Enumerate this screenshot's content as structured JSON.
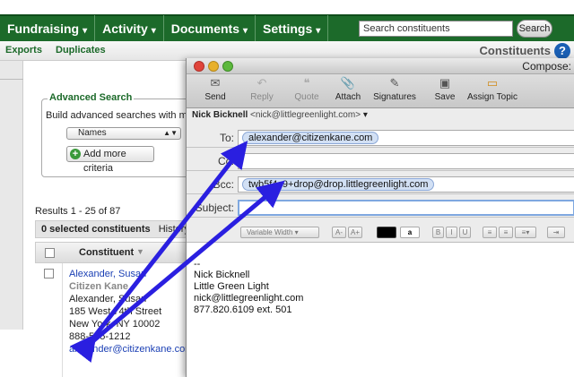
{
  "nav": {
    "items": [
      {
        "label": "Fundraising",
        "caret": "▾"
      },
      {
        "label": "Activity",
        "caret": "▾"
      },
      {
        "label": "Documents",
        "caret": "▾"
      },
      {
        "label": "Settings",
        "caret": "▾"
      }
    ],
    "search_value": "Search constituents",
    "search_button": "Search"
  },
  "subnav": {
    "exports": "Exports",
    "duplicates": "Duplicates",
    "title": "Constituents",
    "help": "?"
  },
  "advanced": {
    "legend": "Advanced Search",
    "description": "Build advanced searches with multip",
    "select_value": "Names",
    "add_button": "Add more criteria"
  },
  "results": {
    "range": "Results 1 - 25 of 87",
    "selected": "0 selected constituents",
    "history": "History",
    "column": "Constituent",
    "row": {
      "name": "Alexander, Susan",
      "company": "Citizen Kane",
      "display": "Alexander, Susan",
      "street": "185 West 74th Street",
      "city": "New York, NY 10002",
      "phone": "888-555-1212",
      "email": "alexander@citizenkane.com"
    }
  },
  "compose": {
    "window_title": "Compose:",
    "toolbar": [
      {
        "label": "Send",
        "icon": "send-icon",
        "glyph": "✉"
      },
      {
        "label": "Reply",
        "icon": "reply-icon",
        "glyph": "↶"
      },
      {
        "label": "Quote",
        "icon": "quote-icon",
        "glyph": "❝"
      },
      {
        "label": "Attach",
        "icon": "paperclip-icon",
        "glyph": "📎"
      },
      {
        "label": "Signatures",
        "icon": "signature-icon",
        "glyph": "✎"
      },
      {
        "label": "Save",
        "icon": "save-icon",
        "glyph": "▣"
      },
      {
        "label": "Assign Topic",
        "icon": "topic-icon",
        "glyph": "▭"
      }
    ],
    "from_name": "Nick Bicknell",
    "from_addr": "<nick@littlegreenlight.com>",
    "from_caret": "▾",
    "to_label": "To:",
    "to_value": "alexander@citizenkane.com",
    "cc_label": "Cc:",
    "bcc_label": "Bcc:",
    "bcc_value": "twb5f4c9+drop@drop.littlegreenlight.com",
    "subject_label": "Subject:",
    "format": {
      "font": "Variable Width",
      "size_down": "A-",
      "size_up": "A+",
      "bold": "B",
      "italic": "I",
      "underline": "U"
    },
    "signature": {
      "dashes": "--",
      "name": "Nick Bicknell",
      "org": "Little Green Light",
      "email": "nick@littlegreenlight.com",
      "phone": "877.820.6109 ext. 501"
    }
  },
  "colors": {
    "nav_green": "#1c6a2a",
    "link_blue": "#1a3fb4",
    "arrow_blue": "#2a1fe0"
  }
}
